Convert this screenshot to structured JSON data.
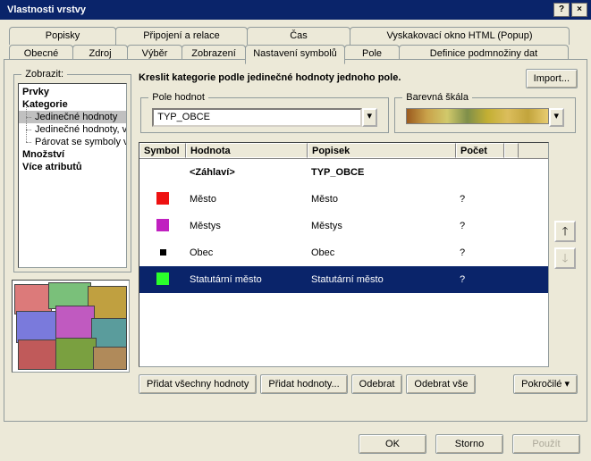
{
  "title": "Vlastnosti vrstvy",
  "tabs_row1": [
    "Popisky",
    "Připojení a relace",
    "Čas",
    "Vyskakovací okno HTML (Popup)"
  ],
  "tabs_row2": [
    "Obecné",
    "Zdroj",
    "Výběr",
    "Zobrazení",
    "Nastavení symbolů",
    "Pole",
    "Definice podmnožiny dat"
  ],
  "active_tab": "Nastavení symbolů",
  "zobrazit_label": "Zobrazit:",
  "tree": {
    "prvky": "Prvky",
    "kategorie": "Kategorie",
    "kat_children": [
      "Jedinečné hodnoty",
      "Jedinečné hodnoty, v",
      "Párovat se symboly v"
    ],
    "mnozstvi": "Množství",
    "vice": "Více atributů"
  },
  "kreslit": "Kreslit kategorie podle jedinečné hodnoty jednoho pole.",
  "import": "Import...",
  "pole_hodnot_label": "Pole hodnot",
  "pole_hodnot_value": "TYP_OBCE",
  "barevna_skala_label": "Barevná škála",
  "grid": {
    "hdr": {
      "symbol": "Symbol",
      "hodnota": "Hodnota",
      "popisek": "Popisek",
      "pocet": "Počet"
    },
    "rows": [
      {
        "swatch": "",
        "hodnota": "<Záhlaví>",
        "popisek": "TYP_OBCE",
        "pocet": "",
        "bold": true
      },
      {
        "swatch": "#e11",
        "hodnota": "Město",
        "popisek": "Město",
        "pocet": "?"
      },
      {
        "swatch": "#c020c0",
        "hodnota": "Městys",
        "popisek": "Městys",
        "pocet": "?"
      },
      {
        "swatch": "#000",
        "hodnota": "Obec",
        "popisek": "Obec",
        "pocet": "?",
        "small": true
      },
      {
        "swatch": "#2bff2b",
        "hodnota": "Statutární město",
        "popisek": "Statutární město",
        "pocet": "?",
        "sel": true
      }
    ]
  },
  "buttons": {
    "pridat_vse": "Přidat všechny hodnoty",
    "pridat": "Přidat hodnoty...",
    "odebrat": "Odebrat",
    "odebrat_vse": "Odebrat vše",
    "pokrocile": "Pokročilé"
  },
  "bottom": {
    "ok": "OK",
    "storno": "Storno",
    "pouzit": "Použít"
  }
}
